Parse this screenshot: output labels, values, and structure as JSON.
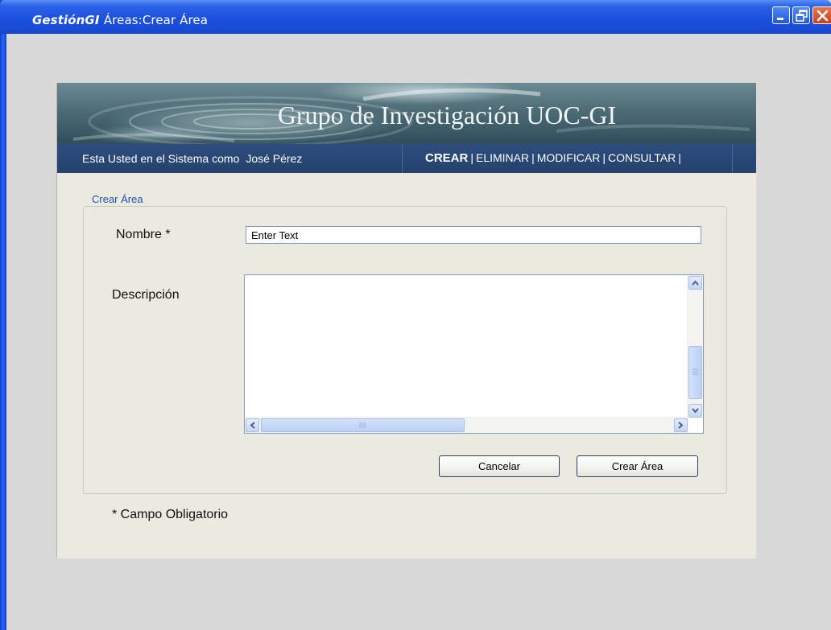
{
  "window": {
    "title_app": "GestiónGI",
    "title_rest": "Áreas:Crear Área",
    "buttons": [
      "minimize-icon",
      "maximize-icon",
      "close-icon"
    ]
  },
  "banner": {
    "title": "Grupo de Investigación UOC-GI"
  },
  "navbar": {
    "user_prefix": "Esta Usted en el Sistema como",
    "user_name": "José Pérez",
    "menu": [
      {
        "label": "CREAR",
        "active": true
      },
      {
        "label": "ELIMINAR",
        "active": false
      },
      {
        "label": "MODIFICAR",
        "active": false
      },
      {
        "label": "CONSULTAR",
        "active": false
      }
    ],
    "separator": "|"
  },
  "form": {
    "legend": "Crear Área",
    "nombre_label": "Nombre *",
    "nombre_value": "Enter Text",
    "descripcion_label": "Descripción",
    "descripcion_value": "",
    "cancel_label": "Cancelar",
    "submit_label": "Crear Área",
    "required_note": "* Campo Obligatorio"
  },
  "colors": {
    "titlebar": "#1b50de",
    "navbar": "#2c4d7e",
    "panel": "#ece9df",
    "legend": "#1f4fb4",
    "background": "#d8d8d8"
  }
}
